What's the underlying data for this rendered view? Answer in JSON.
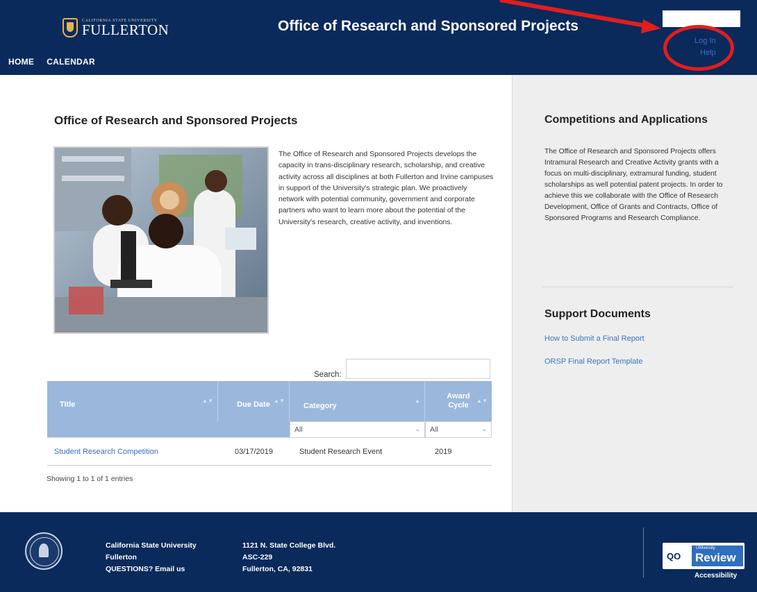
{
  "header": {
    "logo_small": "CALIFORNIA STATE UNIVERSITY",
    "logo_big": "FULLERTON",
    "title": "Office of Research and Sponsored Projects",
    "nav": [
      "HOME",
      "CALENDAR"
    ],
    "login_label": "Log In",
    "help_label": "Help"
  },
  "main": {
    "title": "Office of Research and Sponsored Projects",
    "intro": "The Office of Research and Sponsored Projects develops the capacity in trans-disciplinary research, scholarship, and creative activity across all disciplines at both Fullerton and Irvine campuses in support of the University's strategic plan. We proactively network with potential community, government and corporate partners who want to learn more about the potential of the University's research, creative activity, and inventions.",
    "search_label": "Search:",
    "search_value": "",
    "table": {
      "headers": [
        "Title",
        "Due Date",
        "Category",
        "Award Cycle"
      ],
      "filters": {
        "category": "All",
        "award_cycle": "All"
      },
      "rows": [
        {
          "title": "Student Research Competition",
          "due_date": "03/17/2019",
          "category": "Student Research Event",
          "award_cycle": "2019"
        }
      ]
    },
    "table_info": "Showing 1 to 1 of 1 entries"
  },
  "sidebar": {
    "competitions_title": "Competitions and Applications",
    "competitions_text": "The Office of Research and Sponsored Projects offers Intramural Research and Creative Activity grants with a focus on multi-disciplinary, extramural funding, student scholarships as well potential patent projects. In order to achieve this we collaborate with the Office of Research Development, Office of Grants and Contracts, Office of Sponsored Programs and Research Compliance.",
    "support_title": "Support Documents",
    "support_links": [
      "How to Submit a Final Report",
      "ORSP Final Report Template"
    ]
  },
  "footer": {
    "col1": [
      "California State University",
      "Fullerton",
      "QUESTIONS? Email us"
    ],
    "col2": [
      "1121 N. State College Blvd.",
      "ASC-229",
      "Fullerton, CA, 92831"
    ],
    "badge_small": "UNIversity",
    "badge_review": "Review",
    "badge_access": "Accessibility",
    "badge_logo": "QO"
  },
  "colors": {
    "header_bg": "#0a2a5c",
    "table_header": "#9bb8dc",
    "link": "#3571b8",
    "annotation": "#e31d1d",
    "sidebar_bg": "#eeeeee"
  }
}
